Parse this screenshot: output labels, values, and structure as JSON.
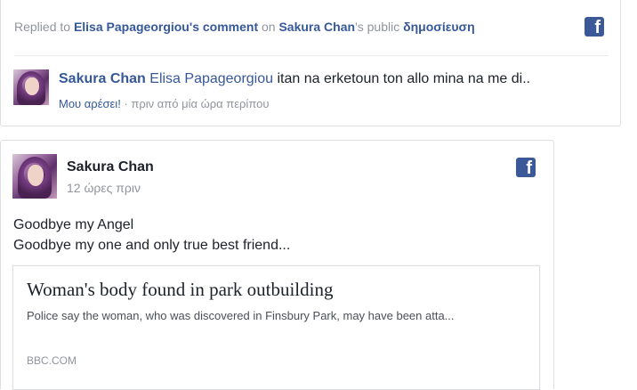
{
  "reply_card": {
    "replied_prefix": "Replied to",
    "commenter_link": "Elisa Papageorgiou's comment",
    "on_word": "on",
    "page_owner": "Sakura Chan",
    "possessive_suffix": "'s public",
    "post_link": "δημοσίευση",
    "comment": {
      "author": "Sakura Chan",
      "mention": "Elisa Papageorgiou",
      "text": "itan na erketoun ton allo mina na me di..",
      "like_label": "Μου αρέσει!",
      "separator": "·",
      "timestamp": "πριν από μία ώρα περίπου"
    }
  },
  "post_card": {
    "author": "Sakura Chan",
    "timestamp": "12 ώρες πριν",
    "body_line1": "Goodbye my Angel",
    "body_line2": "Goodbye my one and only true best friend...",
    "link": {
      "title": "Woman's body found in park outbuilding",
      "description": "Police say the woman, who was discovered in Finsbury Park, may have been atta...",
      "domain": "BBC.COM"
    }
  },
  "icons": {
    "facebook_glyph": "f",
    "facebook_color": "#3b5998"
  }
}
